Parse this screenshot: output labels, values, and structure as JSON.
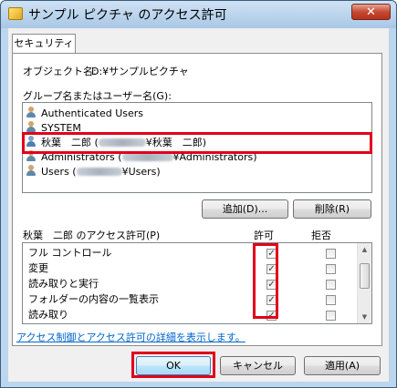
{
  "window": {
    "title": "サンプル ピクチャ のアクセス許可",
    "close_label": "✕"
  },
  "tab": {
    "label": "セキュリティ"
  },
  "object": {
    "label": "オブジェクト名:",
    "value": "D:¥サンプルピクチャ"
  },
  "groups": {
    "label": "グループ名またはユーザー名(G):",
    "items": [
      {
        "name": "Authenticated Users",
        "icon": "group-icon"
      },
      {
        "name": "SYSTEM",
        "icon": "group-icon"
      },
      {
        "name_prefix": "秋葉　二郎 (",
        "name_suffix": "¥秋葉　二郎)",
        "icon": "user-icon",
        "selected": true
      },
      {
        "name_prefix": "Administrators (",
        "name_suffix": "¥Administrators)",
        "icon": "group-icon"
      },
      {
        "name_prefix": "Users (",
        "name_suffix": "¥Users)",
        "icon": "group-icon"
      }
    ]
  },
  "buttons": {
    "add": "追加(D)...",
    "remove": "削除(R)"
  },
  "permissions": {
    "label": "秋葉　二郎 のアクセス許可(P)",
    "allow_header": "許可",
    "deny_header": "拒否",
    "rows": [
      {
        "name": "フル コントロール",
        "allow": true,
        "deny": false
      },
      {
        "name": "変更",
        "allow": true,
        "deny": false
      },
      {
        "name": "読み取りと実行",
        "allow": true,
        "deny": false
      },
      {
        "name": "フォルダーの内容の一覧表示",
        "allow": true,
        "deny": false
      },
      {
        "name": "読み取り",
        "allow": true,
        "deny": false
      }
    ]
  },
  "link": "アクセス制御とアクセス許可の詳細を表示します。",
  "footer": {
    "ok": "OK",
    "cancel": "キャンセル",
    "apply": "適用(A)"
  },
  "colors": {
    "highlight": "#e0001b",
    "link": "#0066cc"
  }
}
